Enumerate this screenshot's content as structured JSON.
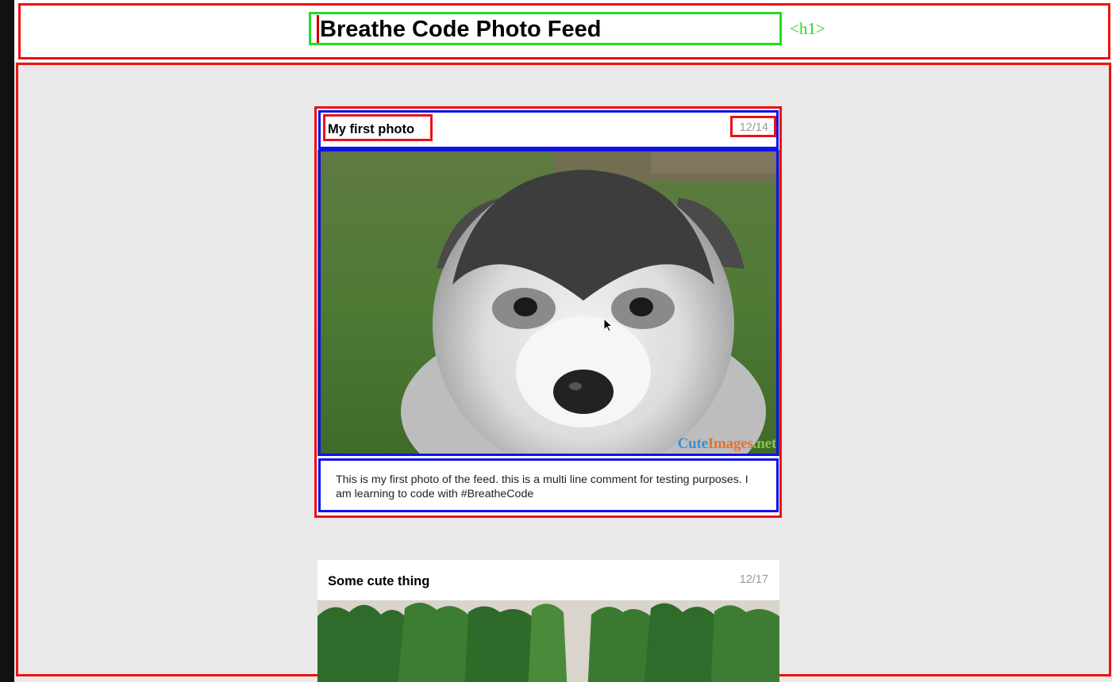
{
  "header": {
    "title": "Breathe Code Photo Feed",
    "tag_label": "<h1>"
  },
  "posts": [
    {
      "title": "My first photo",
      "date": "12/14",
      "caption": "This is my first photo of the feed. this is a multi line comment for testing purposes. I am learning to code with #BreatheCode",
      "photo": "husky-puppy",
      "watermark": [
        "Cute",
        "Images",
        ".net"
      ]
    },
    {
      "title": "Some cute thing",
      "date": "12/17",
      "photo": "green-trees"
    }
  ],
  "colors": {
    "outline_red": "#ee1111",
    "outline_blue": "#1111ee",
    "outline_green": "#22dd22",
    "feed_background": "#e9e9e9"
  }
}
